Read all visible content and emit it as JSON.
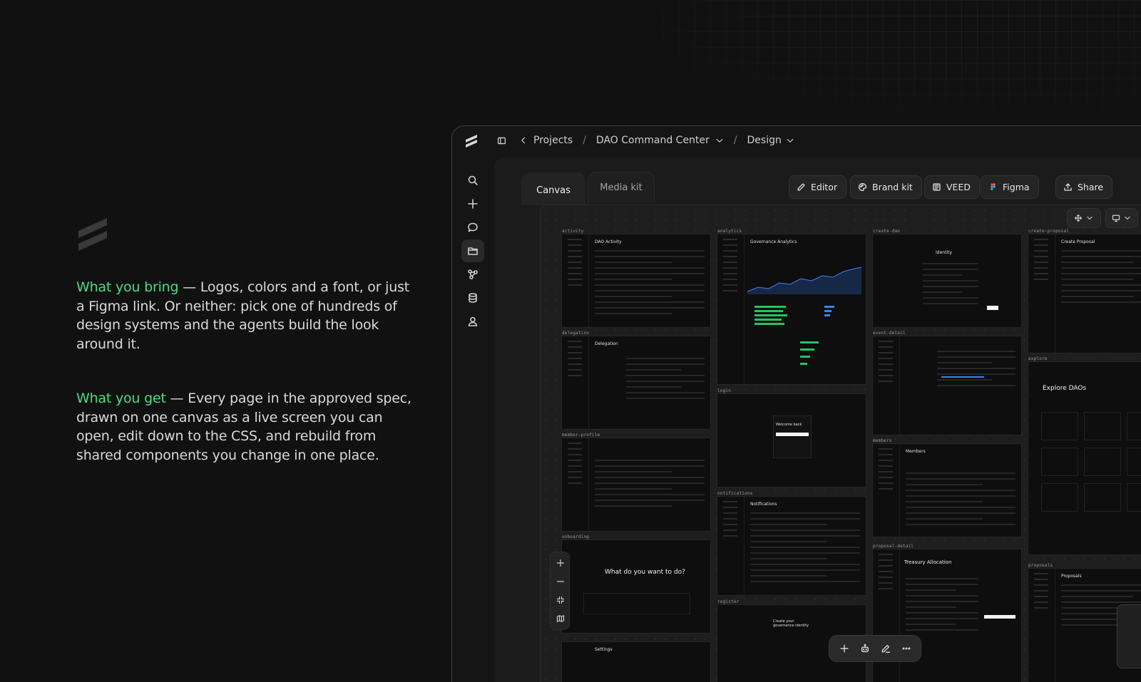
{
  "marketing": {
    "bring_accent": "What you bring",
    "bring_text": " — Logos, colors and a font, or just a Figma link. Or neither: pick one of hundreds of design systems and the agents build the look around it.",
    "get_accent": "What you get",
    "get_text": " — Every page in the approved spec, drawn on one canvas as a live screen you can open, edit down to the CSS, and rebuild from shared components you change in one place."
  },
  "breadcrumb": {
    "projects": "Projects",
    "project": "DAO Command Center",
    "section": "Design",
    "separator": "/"
  },
  "tabs": {
    "canvas": "Canvas",
    "media_kit": "Media kit"
  },
  "toolbar": {
    "editor": "Editor",
    "brand_kit": "Brand kit",
    "veed": "VEED",
    "figma": "Figma",
    "share": "Share"
  },
  "frames": [
    {
      "label": "activity",
      "title": "DAO Activity"
    },
    {
      "label": "delegation",
      "title": "Delegation"
    },
    {
      "label": "member-profile",
      "title": ""
    },
    {
      "label": "onboarding",
      "title": "What do you want to do?"
    },
    {
      "label": "analytics",
      "title": "Governance Analytics"
    },
    {
      "label": "login",
      "title": "Welcome back"
    },
    {
      "label": "notifications",
      "title": "Notifications"
    },
    {
      "label": "register",
      "title": "Create your governance identity"
    },
    {
      "label": "create-dao",
      "title": "Identity"
    },
    {
      "label": "event-detail",
      "title": ""
    },
    {
      "label": "members",
      "title": "Members"
    },
    {
      "label": "proposal-detail",
      "title": "Treasury Allocation"
    },
    {
      "label": "create-proposal",
      "title": "Create Proposal"
    },
    {
      "label": "explore",
      "title": "Explore DAOs"
    },
    {
      "label": "proposals",
      "title": "Proposals"
    },
    {
      "label": "settings",
      "title": "Settings"
    }
  ],
  "colors": {
    "accent_green": "#4ade80",
    "button_green": "#22c55e",
    "background": "#111111"
  }
}
